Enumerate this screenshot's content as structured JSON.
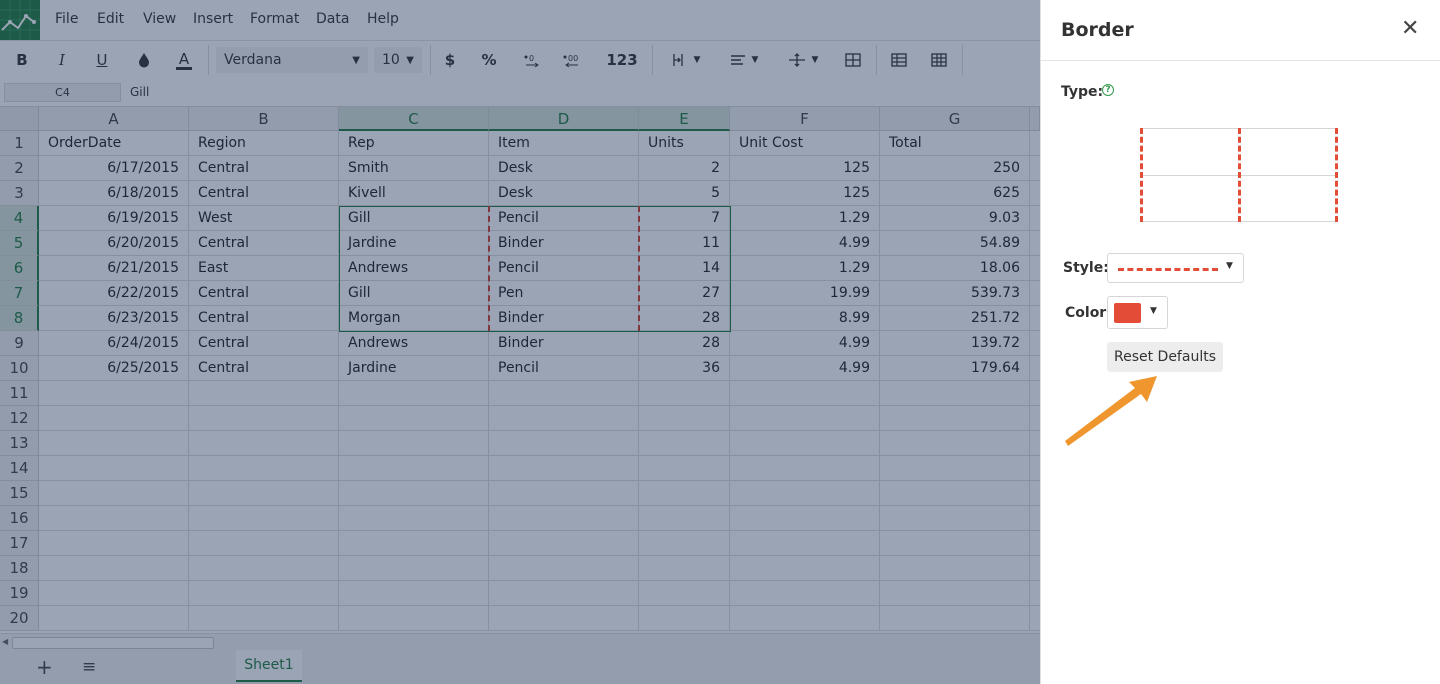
{
  "menu": [
    "File",
    "Edit",
    "View",
    "Insert",
    "Format",
    "Data",
    "Help"
  ],
  "toolbar": {
    "bold": "B",
    "italic": "I",
    "underline": "U",
    "font_color_glyph": "A",
    "font_name": "Verdana",
    "font_size": "10",
    "currency": "$",
    "percent": "%",
    "number_format": "123"
  },
  "formula": {
    "cell_ref": "C4",
    "value": "Gill"
  },
  "columns": [
    "A",
    "B",
    "C",
    "D",
    "E",
    "F",
    "G"
  ],
  "selected_columns": [
    "C",
    "D",
    "E"
  ],
  "rows": [
    "1",
    "2",
    "3",
    "4",
    "5",
    "6",
    "7",
    "8",
    "9",
    "10",
    "11",
    "12",
    "13",
    "14",
    "15",
    "16",
    "17",
    "18",
    "19",
    "20"
  ],
  "selected_rows": [
    "4",
    "5",
    "6",
    "7",
    "8"
  ],
  "cells": [
    [
      "OrderDate",
      "Region",
      "Rep",
      "Item",
      "Units",
      "Unit Cost",
      "Total"
    ],
    [
      "6/17/2015",
      "Central",
      "Smith",
      "Desk",
      "2",
      "125",
      "250"
    ],
    [
      "6/18/2015",
      "Central",
      "Kivell",
      "Desk",
      "5",
      "125",
      "625"
    ],
    [
      "6/19/2015",
      "West",
      "Gill",
      "Pencil",
      "7",
      "1.29",
      "9.03"
    ],
    [
      "6/20/2015",
      "Central",
      "Jardine",
      "Binder",
      "11",
      "4.99",
      "54.89"
    ],
    [
      "6/21/2015",
      "East",
      "Andrews",
      "Pencil",
      "14",
      "1.29",
      "18.06"
    ],
    [
      "6/22/2015",
      "Central",
      "Gill",
      "Pen",
      "27",
      "19.99",
      "539.73"
    ],
    [
      "6/23/2015",
      "Central",
      "Morgan",
      "Binder",
      "28",
      "8.99",
      "251.72"
    ],
    [
      "6/24/2015",
      "Central",
      "Andrews",
      "Binder",
      "28",
      "4.99",
      "139.72"
    ],
    [
      "6/25/2015",
      "Central",
      "Jardine",
      "Pencil",
      "36",
      "4.99",
      "179.64"
    ]
  ],
  "sheet": {
    "tab": "Sheet1",
    "add_glyph": "+",
    "menu_glyph": "≡"
  },
  "panel": {
    "title": "Border",
    "close_glyph": "✕",
    "type_label": "Type:",
    "style_label": "Style:",
    "color_label": "Color:",
    "reset_label": "Reset Defaults",
    "help_glyph": "?"
  },
  "colors": {
    "accent": "#1f7c3f",
    "border_color": "#e34c37",
    "arrow": "#f0962e"
  },
  "icons": [
    "logo-icon",
    "bold-icon",
    "italic-icon",
    "underline-icon",
    "fill-color-icon",
    "font-color-icon",
    "currency-icon",
    "percent-icon",
    "decrease-decimal-icon",
    "increase-decimal-icon",
    "number-format-icon",
    "text-align-horizontal-icon",
    "align-icon",
    "text-wrap-icon",
    "merge-cells-icon",
    "insert-row-icon",
    "insert-column-icon",
    "close-icon",
    "help-icon",
    "chevron-down-icon",
    "menu-icon",
    "add-sheet-icon"
  ]
}
